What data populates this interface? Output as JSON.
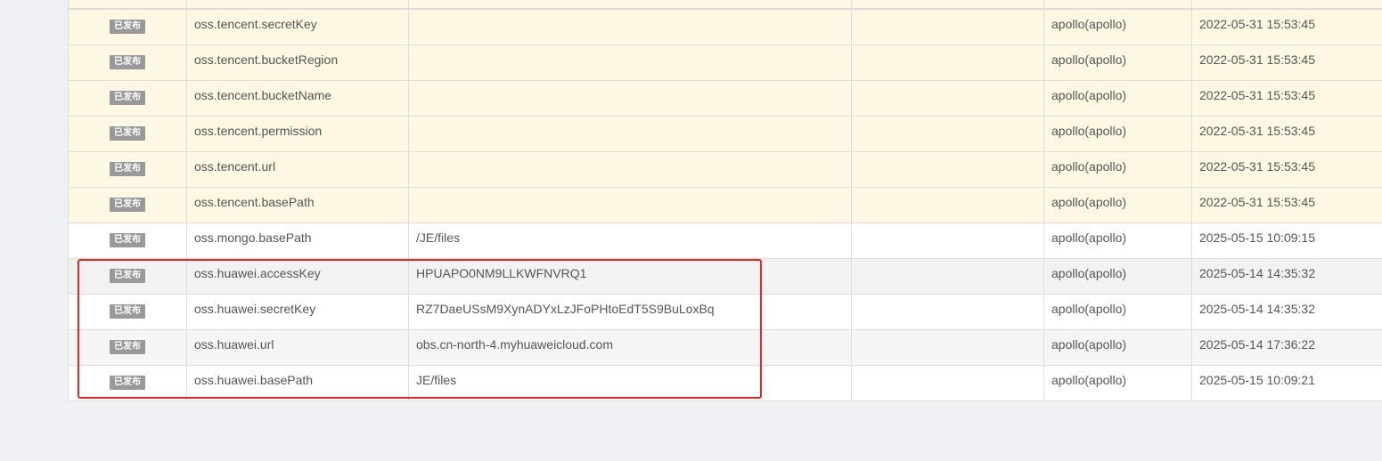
{
  "table": {
    "rows": [
      {
        "status": "已发布",
        "key": "oss.tencent.secretKey",
        "value": "",
        "comment": "",
        "modifier": "apollo(apollo)",
        "time": "2022-05-31 15:53:45"
      },
      {
        "status": "已发布",
        "key": "oss.tencent.bucketRegion",
        "value": "",
        "comment": "",
        "modifier": "apollo(apollo)",
        "time": "2022-05-31 15:53:45"
      },
      {
        "status": "已发布",
        "key": "oss.tencent.bucketName",
        "value": "",
        "comment": "",
        "modifier": "apollo(apollo)",
        "time": "2022-05-31 15:53:45"
      },
      {
        "status": "已发布",
        "key": "oss.tencent.permission",
        "value": "",
        "comment": "",
        "modifier": "apollo(apollo)",
        "time": "2022-05-31 15:53:45"
      },
      {
        "status": "已发布",
        "key": "oss.tencent.url",
        "value": "",
        "comment": "",
        "modifier": "apollo(apollo)",
        "time": "2022-05-31 15:53:45"
      },
      {
        "status": "已发布",
        "key": "oss.tencent.basePath",
        "value": "",
        "comment": "",
        "modifier": "apollo(apollo)",
        "time": "2022-05-31 15:53:45"
      },
      {
        "status": "已发布",
        "key": "oss.mongo.basePath",
        "value": "/JE/files",
        "comment": "",
        "modifier": "apollo(apollo)",
        "time": "2025-05-15 10:09:15"
      },
      {
        "status": "已发布",
        "key": "oss.huawei.accessKey",
        "value": "HPUAPO0NM9LLKWFNVRQ1",
        "comment": "",
        "modifier": "apollo(apollo)",
        "time": "2025-05-14 14:35:32"
      },
      {
        "status": "已发布",
        "key": "oss.huawei.secretKey",
        "value": "RZ7DaeUSsM9XynADYxLzJFoPHtoEdT5S9BuLoxBq",
        "comment": "",
        "modifier": "apollo(apollo)",
        "time": "2025-05-14 14:35:32"
      },
      {
        "status": "已发布",
        "key": "oss.huawei.url",
        "value": "obs.cn-north-4.myhuaweicloud.com",
        "comment": "",
        "modifier": "apollo(apollo)",
        "time": "2025-05-14 17:36:22"
      },
      {
        "status": "已发布",
        "key": "oss.huawei.basePath",
        "value": "JE/files",
        "comment": "",
        "modifier": "apollo(apollo)",
        "time": "2025-05-15 10:09:21"
      }
    ]
  },
  "colors": {
    "page_background": "#f0f1f5",
    "tencent_row_background": "#fcf8e3",
    "badge_background": "#999999",
    "highlight_border": "#f02424"
  }
}
